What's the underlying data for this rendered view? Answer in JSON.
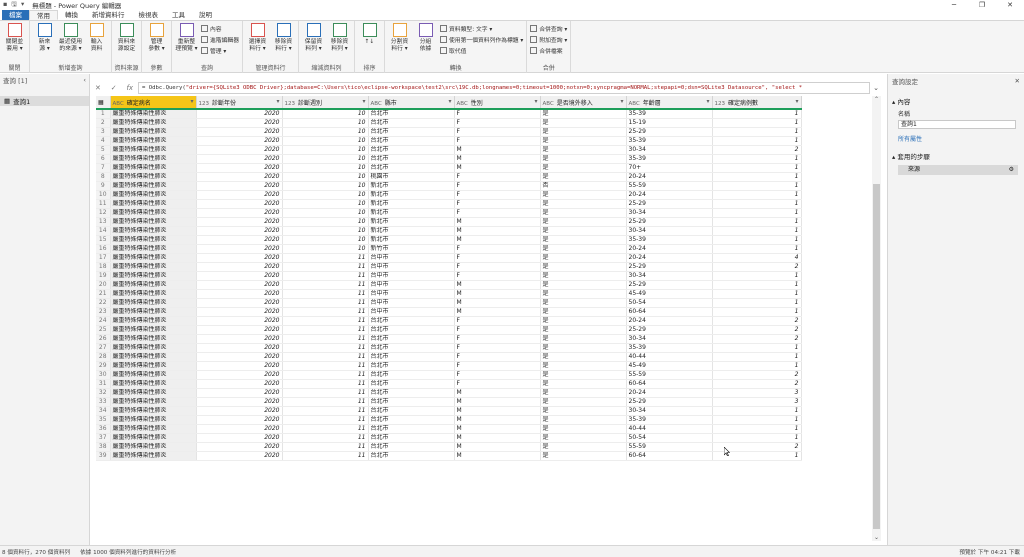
{
  "window": {
    "title": "無標題 - Power Query 編輯器",
    "controls": {
      "minimize": "─",
      "restore": "❐",
      "close": "✕"
    }
  },
  "ribbon_tabs": [
    "檔案",
    "常用",
    "轉換",
    "新增資料行",
    "檢視表",
    "工具",
    "說明"
  ],
  "ribbon": {
    "groups": [
      {
        "label": "關閉",
        "big": [
          "關閉並\n套用 ▾"
        ],
        "small": []
      },
      {
        "label": "新增查詢",
        "big": [
          "新來\n源 ▾",
          "最近使用\n的來源 ▾",
          "輸入\n資料"
        ],
        "small": []
      },
      {
        "label": "資料來源",
        "big": [
          "資料來\n源設定"
        ],
        "small": []
      },
      {
        "label": "參數",
        "big": [
          "管理\n參數 ▾"
        ],
        "small": []
      },
      {
        "label": "查詢",
        "big": [
          "重新整\n理預覽 ▾"
        ],
        "small": [
          "內容",
          "進階編輯器",
          "管理 ▾"
        ]
      },
      {
        "label": "管理資料行",
        "big": [
          "選擇資\n料行 ▾",
          "移除資\n料行 ▾"
        ],
        "small": []
      },
      {
        "label": "縮減資料列",
        "big": [
          "保留資\n料列 ▾",
          "移除資\n料列 ▾"
        ],
        "small": []
      },
      {
        "label": "排序",
        "big": [
          "↑↓"
        ],
        "small": []
      },
      {
        "label": "轉換",
        "big": [
          "分割資\n料行 ▾",
          "分組\n依據"
        ],
        "small": [
          "資料類型: 文字 ▾",
          "使用第一個資料列作為標題 ▾",
          "取代值"
        ]
      },
      {
        "label": "合併",
        "big": [],
        "small": [
          "合併查詢 ▾",
          "附加查詢 ▾",
          "合併檔案"
        ]
      }
    ]
  },
  "formula": {
    "prefix": "= Odbc.Query(",
    "text": "\"driver={SQLite3 ODBC Driver};database=C:\\Users\\tico\\eclipse-workspace\\test2\\src\\19C.db;longnames=0;timeout=1000;notxn=0;syncpragma=NORMAL;stepapi=0;dsn=SQLite3 Datasource\", \"select *"
  },
  "queries_pane": {
    "title": "查詢 [1]",
    "items": [
      "查詢1"
    ]
  },
  "settings_pane": {
    "title": "查詢設定",
    "properties_heading": "內容",
    "name_label": "名稱",
    "name_value": "查詢1",
    "all_properties": "所有屬性",
    "steps_heading": "套用的步驟",
    "steps": [
      "來源"
    ]
  },
  "table": {
    "columns": [
      {
        "type": "ABC",
        "name": "確定病名"
      },
      {
        "type": "123",
        "name": "診斷年份"
      },
      {
        "type": "123",
        "name": "診斷週別"
      },
      {
        "type": "ABC",
        "name": "縣市"
      },
      {
        "type": "ABC",
        "name": "性別"
      },
      {
        "type": "ABC",
        "name": "是否境外移入"
      },
      {
        "type": "ABC",
        "name": "年齡層"
      },
      {
        "type": "123",
        "name": "確定病例數"
      }
    ],
    "rows": [
      [
        "嚴重特殊傳染性肺炎",
        "2020",
        "10",
        "台北市",
        "F",
        "是",
        "35-39",
        "1"
      ],
      [
        "嚴重特殊傳染性肺炎",
        "2020",
        "10",
        "台北市",
        "F",
        "是",
        "15-19",
        "1"
      ],
      [
        "嚴重特殊傳染性肺炎",
        "2020",
        "10",
        "台北市",
        "F",
        "是",
        "25-29",
        "1"
      ],
      [
        "嚴重特殊傳染性肺炎",
        "2020",
        "10",
        "台北市",
        "F",
        "是",
        "35-39",
        "1"
      ],
      [
        "嚴重特殊傳染性肺炎",
        "2020",
        "10",
        "台北市",
        "M",
        "是",
        "30-34",
        "2"
      ],
      [
        "嚴重特殊傳染性肺炎",
        "2020",
        "10",
        "台北市",
        "M",
        "是",
        "35-39",
        "1"
      ],
      [
        "嚴重特殊傳染性肺炎",
        "2020",
        "10",
        "台北市",
        "M",
        "是",
        "70+",
        "1"
      ],
      [
        "嚴重特殊傳染性肺炎",
        "2020",
        "10",
        "桃園市",
        "F",
        "是",
        "20-24",
        "1"
      ],
      [
        "嚴重特殊傳染性肺炎",
        "2020",
        "10",
        "新北市",
        "F",
        "否",
        "55-59",
        "1"
      ],
      [
        "嚴重特殊傳染性肺炎",
        "2020",
        "10",
        "新北市",
        "F",
        "是",
        "20-24",
        "1"
      ],
      [
        "嚴重特殊傳染性肺炎",
        "2020",
        "10",
        "新北市",
        "F",
        "是",
        "25-29",
        "1"
      ],
      [
        "嚴重特殊傳染性肺炎",
        "2020",
        "10",
        "新北市",
        "F",
        "是",
        "30-34",
        "1"
      ],
      [
        "嚴重特殊傳染性肺炎",
        "2020",
        "10",
        "新北市",
        "M",
        "是",
        "25-29",
        "1"
      ],
      [
        "嚴重特殊傳染性肺炎",
        "2020",
        "10",
        "新北市",
        "M",
        "是",
        "30-34",
        "1"
      ],
      [
        "嚴重特殊傳染性肺炎",
        "2020",
        "10",
        "新北市",
        "M",
        "是",
        "35-39",
        "1"
      ],
      [
        "嚴重特殊傳染性肺炎",
        "2020",
        "10",
        "新竹市",
        "F",
        "是",
        "20-24",
        "1"
      ],
      [
        "嚴重特殊傳染性肺炎",
        "2020",
        "11",
        "台中市",
        "F",
        "是",
        "20-24",
        "4"
      ],
      [
        "嚴重特殊傳染性肺炎",
        "2020",
        "11",
        "台中市",
        "F",
        "是",
        "25-29",
        "2"
      ],
      [
        "嚴重特殊傳染性肺炎",
        "2020",
        "11",
        "台中市",
        "F",
        "是",
        "30-34",
        "1"
      ],
      [
        "嚴重特殊傳染性肺炎",
        "2020",
        "11",
        "台中市",
        "M",
        "是",
        "25-29",
        "1"
      ],
      [
        "嚴重特殊傳染性肺炎",
        "2020",
        "11",
        "台中市",
        "M",
        "是",
        "45-49",
        "1"
      ],
      [
        "嚴重特殊傳染性肺炎",
        "2020",
        "11",
        "台中市",
        "M",
        "是",
        "50-54",
        "1"
      ],
      [
        "嚴重特殊傳染性肺炎",
        "2020",
        "11",
        "台中市",
        "M",
        "是",
        "60-64",
        "1"
      ],
      [
        "嚴重特殊傳染性肺炎",
        "2020",
        "11",
        "台北市",
        "F",
        "是",
        "20-24",
        "2"
      ],
      [
        "嚴重特殊傳染性肺炎",
        "2020",
        "11",
        "台北市",
        "F",
        "是",
        "25-29",
        "2"
      ],
      [
        "嚴重特殊傳染性肺炎",
        "2020",
        "11",
        "台北市",
        "F",
        "是",
        "30-34",
        "2"
      ],
      [
        "嚴重特殊傳染性肺炎",
        "2020",
        "11",
        "台北市",
        "F",
        "是",
        "35-39",
        "1"
      ],
      [
        "嚴重特殊傳染性肺炎",
        "2020",
        "11",
        "台北市",
        "F",
        "是",
        "40-44",
        "1"
      ],
      [
        "嚴重特殊傳染性肺炎",
        "2020",
        "11",
        "台北市",
        "F",
        "是",
        "45-49",
        "1"
      ],
      [
        "嚴重特殊傳染性肺炎",
        "2020",
        "11",
        "台北市",
        "F",
        "是",
        "55-59",
        "2"
      ],
      [
        "嚴重特殊傳染性肺炎",
        "2020",
        "11",
        "台北市",
        "F",
        "是",
        "60-64",
        "2"
      ],
      [
        "嚴重特殊傳染性肺炎",
        "2020",
        "11",
        "台北市",
        "M",
        "是",
        "20-24",
        "3"
      ],
      [
        "嚴重特殊傳染性肺炎",
        "2020",
        "11",
        "台北市",
        "M",
        "是",
        "25-29",
        "3"
      ],
      [
        "嚴重特殊傳染性肺炎",
        "2020",
        "11",
        "台北市",
        "M",
        "是",
        "30-34",
        "1"
      ],
      [
        "嚴重特殊傳染性肺炎",
        "2020",
        "11",
        "台北市",
        "M",
        "是",
        "35-39",
        "1"
      ],
      [
        "嚴重特殊傳染性肺炎",
        "2020",
        "11",
        "台北市",
        "M",
        "是",
        "40-44",
        "1"
      ],
      [
        "嚴重特殊傳染性肺炎",
        "2020",
        "11",
        "台北市",
        "M",
        "是",
        "50-54",
        "1"
      ],
      [
        "嚴重特殊傳染性肺炎",
        "2020",
        "11",
        "台北市",
        "M",
        "是",
        "55-59",
        "2"
      ],
      [
        "嚴重特殊傳染性肺炎",
        "2020",
        "11",
        "台北市",
        "M",
        "是",
        "60-64",
        "1"
      ]
    ]
  },
  "status": {
    "left": "8 個資料行，270 個資料列",
    "middle": "依據 1000 個資料列進行的資料行分析",
    "right": "預覽於 下午 04:21 下載"
  }
}
